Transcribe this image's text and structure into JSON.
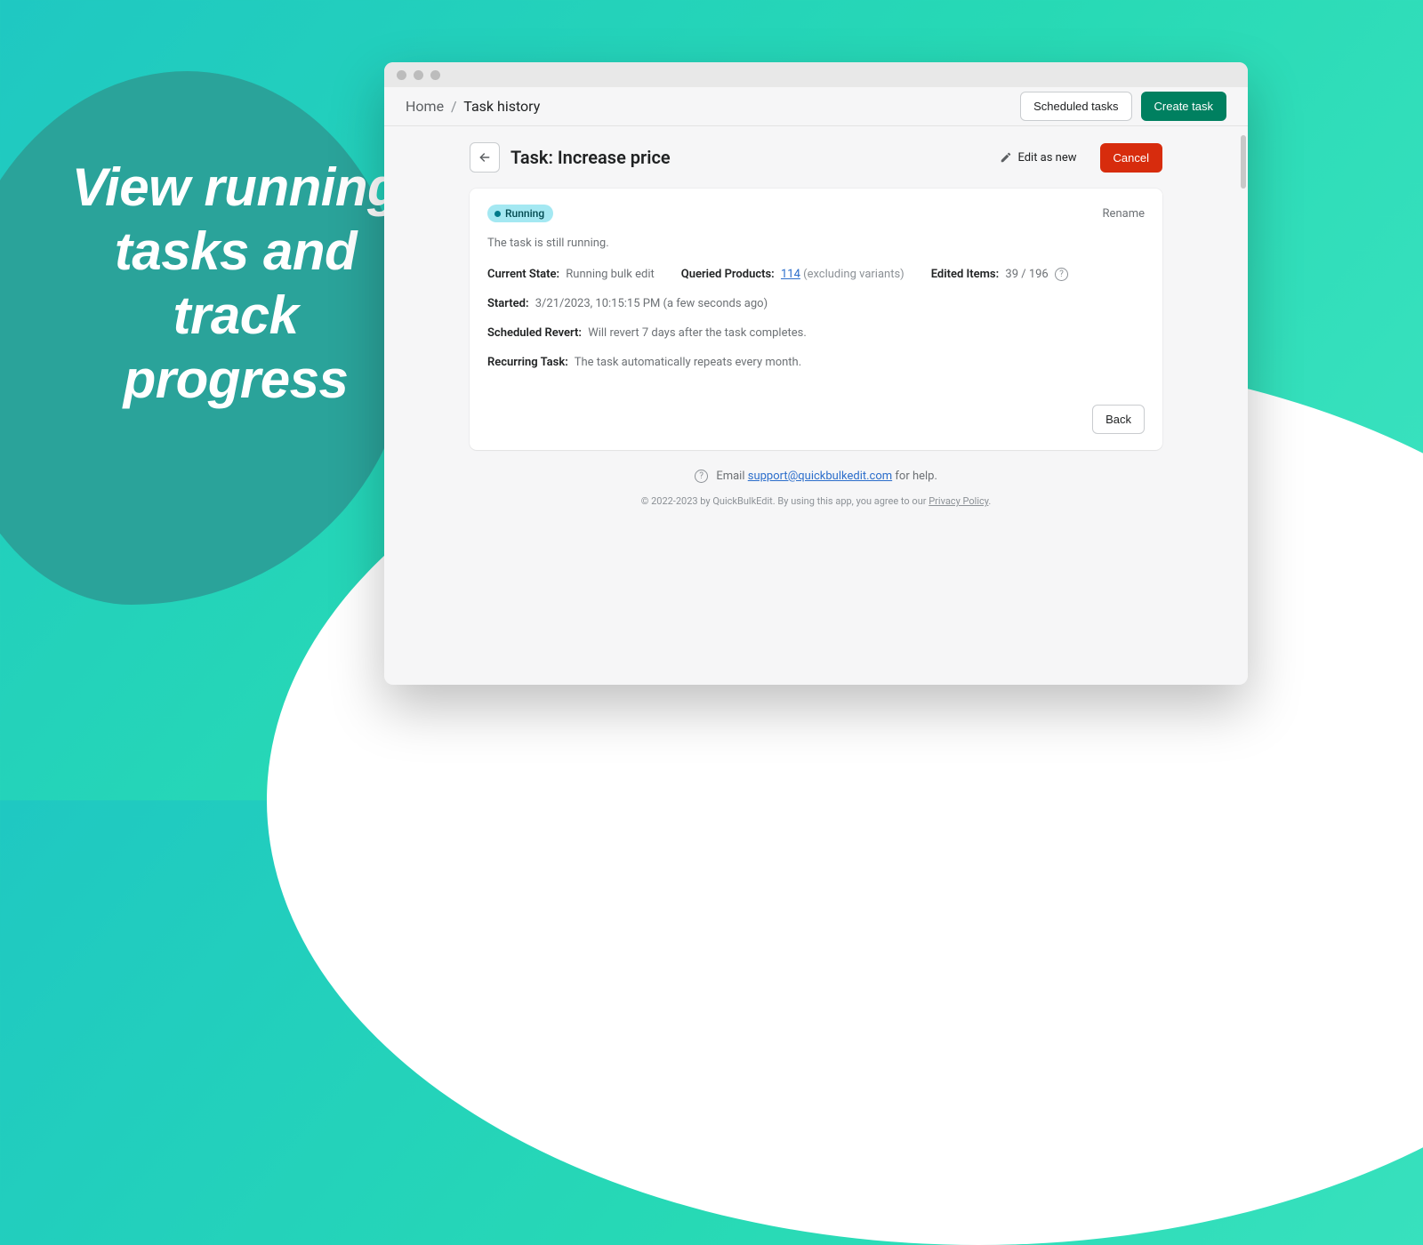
{
  "hero": "View running tasks and track progress",
  "breadcrumb": {
    "home": "Home",
    "current": "Task history"
  },
  "topbar": {
    "scheduled_tasks": "Scheduled tasks",
    "create_task": "Create task"
  },
  "page": {
    "title": "Task: Increase price",
    "edit_as_new": "Edit as new",
    "cancel": "Cancel"
  },
  "card": {
    "badge": "Running",
    "rename": "Rename",
    "status_text": "The task is still running.",
    "current_state_label": "Current State:",
    "current_state_value": "Running bulk edit",
    "queried_label": "Queried Products:",
    "queried_count": "114",
    "queried_suffix": "(excluding variants)",
    "edited_label": "Edited Items:",
    "edited_value": "39 / 196",
    "started_label": "Started:",
    "started_value": "3/21/2023, 10:15:15 PM (a few seconds ago)",
    "revert_label": "Scheduled Revert:",
    "revert_value": "Will revert 7 days after the task completes.",
    "recurring_label": "Recurring Task:",
    "recurring_value": "The task automatically repeats every month.",
    "back": "Back"
  },
  "footer": {
    "pre": "Email ",
    "email": "support@quickbulkedit.com",
    "post": " for help."
  },
  "copyright": {
    "pre": "© 2022-2023 by QuickBulkEdit. By using this app, you agree to our ",
    "link": "Privacy Policy",
    "post": "."
  }
}
